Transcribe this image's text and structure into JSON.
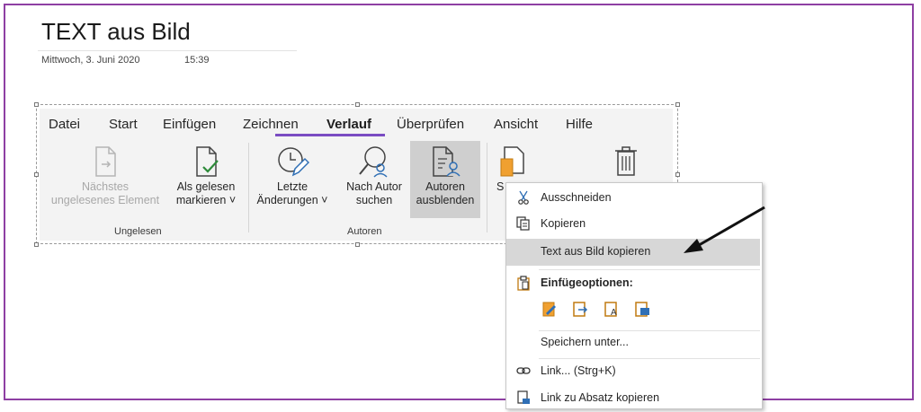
{
  "page": {
    "title": "TEXT aus Bild",
    "date": "Mittwoch, 3. Juni 2020",
    "time": "15:39"
  },
  "ribbon": {
    "tabs": [
      "Datei",
      "Start",
      "Einfügen",
      "Zeichnen",
      "Verlauf",
      "Überprüfen",
      "Ansicht",
      "Hilfe"
    ],
    "active_tab": "Verlauf",
    "buttons": {
      "next_unread": {
        "line1": "Nächstes",
        "line2": "ungelesenes Element"
      },
      "mark_read": {
        "line1": "Als gelesen",
        "line2": "markieren ˅"
      },
      "recent_changes": {
        "line1": "Letzte",
        "line2": "Änderungen ˅"
      },
      "search_author": {
        "line1": "Nach Autor",
        "line2": "suchen"
      },
      "hide_authors": {
        "line1": "Autoren",
        "line2": "ausblenden"
      },
      "partial_s": "S"
    },
    "groups": {
      "unread": "Ungelesen",
      "authors": "Autoren"
    }
  },
  "context_menu": {
    "items": {
      "cut": "Ausschneiden",
      "copy": "Kopieren",
      "copy_text_from_image": "Text aus Bild kopieren",
      "paste_options": "Einfügeoptionen:",
      "save_as": "Speichern unter...",
      "link": "Link...  (Strg+K)",
      "link_paragraph": "Link zu Absatz kopieren"
    },
    "paste_icons": [
      "paste-keep-formatting-icon",
      "paste-merge-icon",
      "paste-text-only-icon",
      "paste-picture-icon"
    ]
  },
  "colors": {
    "frame": "#8e3fa3",
    "accent": "#7a4cc2",
    "highlight": "#d7d7d7",
    "paste_orange": "#f0a030",
    "paste_blue": "#2f6fb5"
  }
}
